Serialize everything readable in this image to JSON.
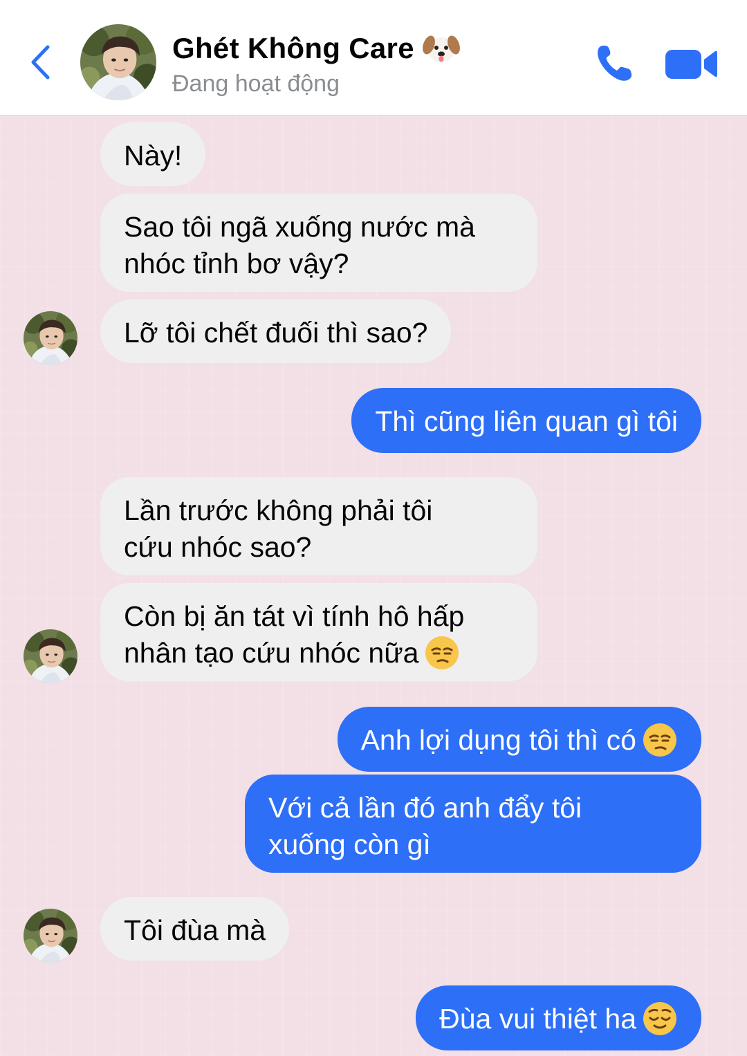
{
  "header": {
    "contact_name": "Ghét Không Care",
    "title_emoji": "dog-face-emoji",
    "status": "Đang hoạt động",
    "back_icon": "chevron-left-icon",
    "call_icon": "phone-icon",
    "video_icon": "video-camera-icon"
  },
  "colors": {
    "accent": "#2d6ff7",
    "incoming_bubble": "#efeff0",
    "chat_background": "#f3dfe6"
  },
  "messages": [
    {
      "direction": "incoming",
      "lines": [
        "Này!"
      ]
    },
    {
      "direction": "incoming",
      "lines": [
        "Sao tôi ngã xuống nước mà",
        "nhóc tỉnh bơ vậy?"
      ]
    },
    {
      "direction": "incoming",
      "lines": [
        "Lỡ tôi chết đuối thì sao?"
      ]
    },
    {
      "direction": "outgoing",
      "lines": [
        "Thì cũng liên quan gì tôi"
      ]
    },
    {
      "direction": "incoming",
      "lines": [
        "Lần trước không phải tôi",
        "cứu nhóc sao?"
      ]
    },
    {
      "direction": "incoming",
      "lines": [
        "Còn bị ăn tát vì tính hô hấp",
        "nhân tạo cứu nhóc nữa"
      ],
      "emoji": "unamused-face-emoji"
    },
    {
      "direction": "outgoing",
      "lines": [
        "Anh lợi dụng tôi thì có"
      ],
      "emoji": "unamused-face-emoji"
    },
    {
      "direction": "outgoing",
      "lines": [
        "Với cả lần đó anh đẩy tôi",
        "xuống còn gì"
      ]
    },
    {
      "direction": "incoming",
      "lines": [
        "Tôi đùa mà"
      ]
    },
    {
      "direction": "outgoing",
      "lines": [
        "Đùa vui thiệt ha"
      ],
      "emoji": "relieved-face-emoji"
    }
  ]
}
